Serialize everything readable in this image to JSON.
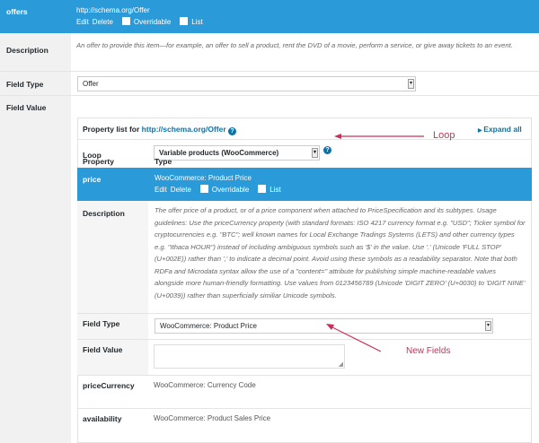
{
  "offers_row": {
    "name": "offers",
    "type_url": "http://schema.org/Offer",
    "edit": "Edit",
    "delete": "Delete",
    "overridable": "Overridable",
    "list": "List"
  },
  "description": {
    "label": "Description",
    "text": "An offer to provide this item—for example, an offer to sell a product, rent the DVD of a movie, perform a service, or give away tickets to an event."
  },
  "field_type": {
    "label": "Field Type",
    "value": "Offer"
  },
  "field_value": {
    "label": "Field Value"
  },
  "property_list": {
    "prefix": "Property list for",
    "url": "http://schema.org/Offer",
    "help": "?",
    "expand_all": "Expand all",
    "loop_label": "Loop",
    "loop_value": "Variable products (WooCommerce)",
    "col_property": "Property",
    "col_type": "Type"
  },
  "price": {
    "name": "price",
    "type": "WooCommerce: Product Price",
    "edit": "Edit",
    "delete": "Delete",
    "overridable": "Overridable",
    "list": "List",
    "description_label": "Description",
    "description": "The offer price of a product, or of a price component when attached to PriceSpecification and its subtypes. Usage guidelines: Use the priceCurrency property (with standard formats: ISO 4217 currency format e.g. \"USD\"; Ticker symbol for cryptocurrencies e.g. \"BTC\"; well known names for Local Exchange Tradings Systems (LETS) and other currency types e.g. \"Ithaca HOUR\") instead of including ambiguous symbols such as '$' in the value. Use '.' (Unicode 'FULL STOP' (U+002E)) rather than ',' to indicate a decimal point. Avoid using these symbols as a readability separator. Note that both RDFa and Microdata syntax allow the use of a \"content=\" attribute for publishing simple machine-readable values alongside more human-friendly formatting. Use values from 0123456789 (Unicode 'DIGIT ZERO' (U+0030) to 'DIGIT NINE' (U+0039)) rather than superficially similiar Unicode symbols.",
    "field_type_label": "Field Type",
    "field_type_value": "WooCommerce: Product Price",
    "field_value_label": "Field Value",
    "field_value": ""
  },
  "other_props": [
    {
      "name": "priceCurrency",
      "type": "WooCommerce: Currency Code"
    },
    {
      "name": "availability",
      "type": "WooCommerce: Product Sales Price"
    }
  ],
  "annotations": {
    "loop": "Loop",
    "new_fields": "New Fields",
    "color": "#c8305a"
  }
}
